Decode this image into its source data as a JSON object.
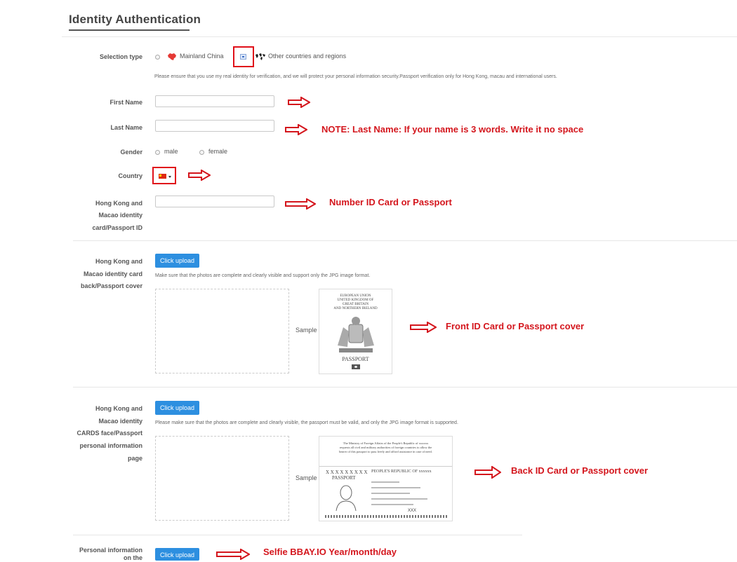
{
  "page": {
    "title": "Identity Authentication"
  },
  "selection": {
    "label": "Selection type",
    "option_mainland": "Mainland China",
    "option_other": "Other countries and regions",
    "notice": "Please ensure that you use my real identity for verification, and we will protect your personal information security.Passport verification only for Hong Kong, macau and international users."
  },
  "first_name": {
    "label": "First Name",
    "value": ""
  },
  "last_name": {
    "label": "Last Name",
    "value": "",
    "note": "NOTE: Last Name: If your name is 3 words. Write it no space"
  },
  "gender": {
    "label": "Gender",
    "male": "male",
    "female": "female"
  },
  "country": {
    "label": "Country",
    "flag_icon": "china-flag-icon"
  },
  "id_number": {
    "label_1": "Hong Kong and",
    "label_2": "Macao identity",
    "label_3": "card/Passport ID",
    "value": "",
    "note": "Number ID Card or Passport"
  },
  "upload_cover": {
    "label_1": "Hong Kong and",
    "label_2": "Macao identity card",
    "label_3": "back/Passport cover",
    "button": "Click upload",
    "hint": "Make sure that the photos are complete and clearly visible and support only the JPG image format.",
    "sample_label": "Sample",
    "sample_text_1": "EUROPEAN UNION",
    "sample_text_2": "UNITED KINGDOM OF",
    "sample_text_3": "GREAT BRITAIN",
    "sample_text_4": "AND NORTHERN IRELAND",
    "sample_text_5": "PASSPORT",
    "note": "Front ID Card or Passport cover"
  },
  "upload_info": {
    "label_1": "Hong Kong and",
    "label_2": "Macao identity",
    "label_3": "CARDS face/Passport",
    "label_4": "personal information",
    "label_5": "page",
    "button": "Click upload",
    "hint": "Please make sure that the photos are complete and clearly visible, the passport must be valid, and only the JPG image format is supported.",
    "sample_label": "Sample",
    "sample_text_1": "The Ministry of Foreign Affairs of the People's Republic of xxxxxx",
    "sample_text_2": "requests all civil and military authorities of foreign countries to allow the",
    "sample_text_3": "bearer of this passport to pass freely and afford assistance in case of need.",
    "sample_text_4": "X X X X X X X X X",
    "sample_text_5": "PASSPORT",
    "sample_text_6": "PEOPLE'S REPUBLIC OF xxxxxx",
    "sample_text_7": "XXX",
    "note": "Back ID Card or Passport cover"
  },
  "upload_selfie": {
    "label_1": "Personal information",
    "label_2": "on the",
    "button": "Click upload",
    "note": "Selfie BBAY.IO Year/month/day"
  },
  "colors": {
    "accent": "#2d8fe0",
    "annotation": "#d4161d"
  }
}
